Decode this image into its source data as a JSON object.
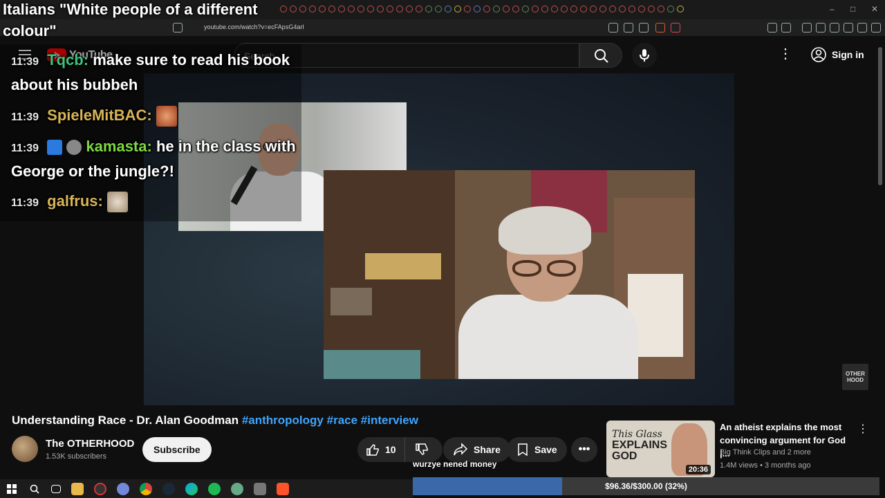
{
  "browser": {
    "url": "youtube.com/watch?v=ecFApsG4arI"
  },
  "youtube": {
    "logo_text": "YouTube",
    "search_placeholder": "Search",
    "signin_label": "Sign in"
  },
  "chat": {
    "title": "Italians \"White people of a different colour\"",
    "messages": [
      {
        "time": "11:39",
        "user": "Tqcb:",
        "user_color": "#3cc47c",
        "text": "make sure to read his book about his bubbeh"
      },
      {
        "time": "11:39",
        "user": "SpieleMitBAC:",
        "user_color": "#d8b457",
        "text": ""
      },
      {
        "time": "11:39",
        "user": "kamasta:",
        "user_color": "#7cd840",
        "text": "he in the class with George or the jungle?!"
      },
      {
        "time": "11:39",
        "user": "galfrus:",
        "user_color": "#d8b457",
        "text": ""
      }
    ]
  },
  "video": {
    "title": "Understanding Race - Dr. Alan Goodman",
    "hashtags": [
      "#anthropology",
      "#race",
      "#interview"
    ],
    "watermark": "OTHER HOOD",
    "channel_name": "The OTHERHOOD",
    "subscribers": "1.53K subscribers",
    "subscribe_label": "Subscribe",
    "like_count": "10",
    "share_label": "Share",
    "save_label": "Save"
  },
  "recommended": {
    "thumb_line1": "This Glass",
    "thumb_line2": "EXPLAINS",
    "thumb_line3": "GOD",
    "duration": "20:36",
    "title": "An atheist explains the most convincing argument for God |...",
    "channel": "Big Think Clips and 2 more",
    "meta": "1.4M views • 3 months ago"
  },
  "donation": {
    "name": "wurzye nened money",
    "progress_text": "$96.36/$300.00 (32%)",
    "progress_fraction": 0.32
  },
  "colors": {
    "accent_link": "#3ea6ff",
    "youtube_red": "#ff0000",
    "donation_fill": "#3b68a8"
  }
}
